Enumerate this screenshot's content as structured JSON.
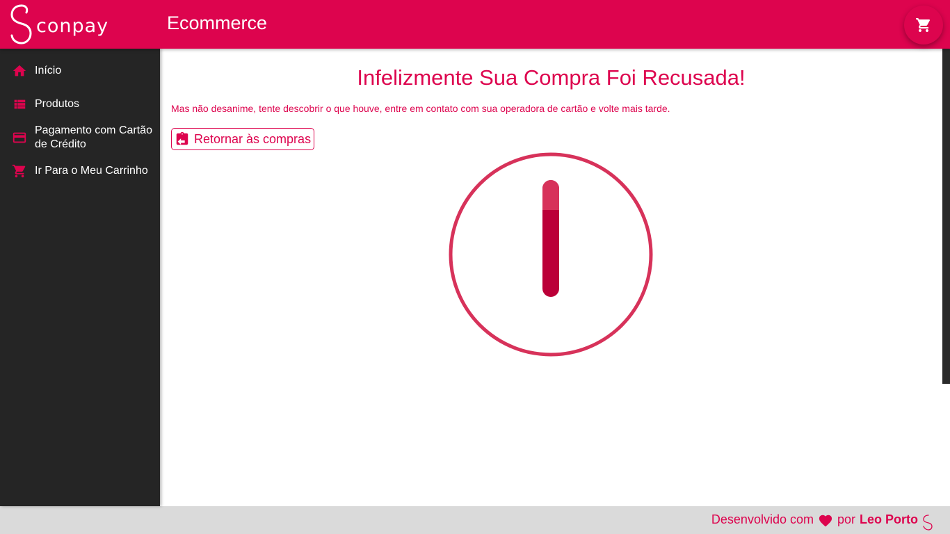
{
  "header": {
    "logo_text": "conpay",
    "title": "Ecommerce",
    "cart_icon": "cart-icon"
  },
  "sidebar": {
    "items": [
      {
        "label": "Início",
        "icon": "home-icon"
      },
      {
        "label": "Produtos",
        "icon": "list-icon"
      },
      {
        "label": "Pagamento com Cartão de Crédito",
        "icon": "credit-card-icon"
      },
      {
        "label": "Ir Para o Meu Carrinho",
        "icon": "cart-icon"
      }
    ]
  },
  "main": {
    "heading": "Infelizmente Sua Compra Foi Recusada!",
    "message": "Mas não desanime, tente descobrir o que houve, entre em contato com sua operadora de cartão e volte mais tarde.",
    "return_button": "Retornar às compras",
    "graphic_icon": "exclamation-circle-icon"
  },
  "footer": {
    "prefix": "Desenvolvido com",
    "heart_icon": "heart-icon",
    "by": "por",
    "author": "Leo Porto"
  },
  "colors": {
    "brand": "#dd044e",
    "sidebar_bg": "#252525",
    "footer_bg": "#dadada"
  }
}
